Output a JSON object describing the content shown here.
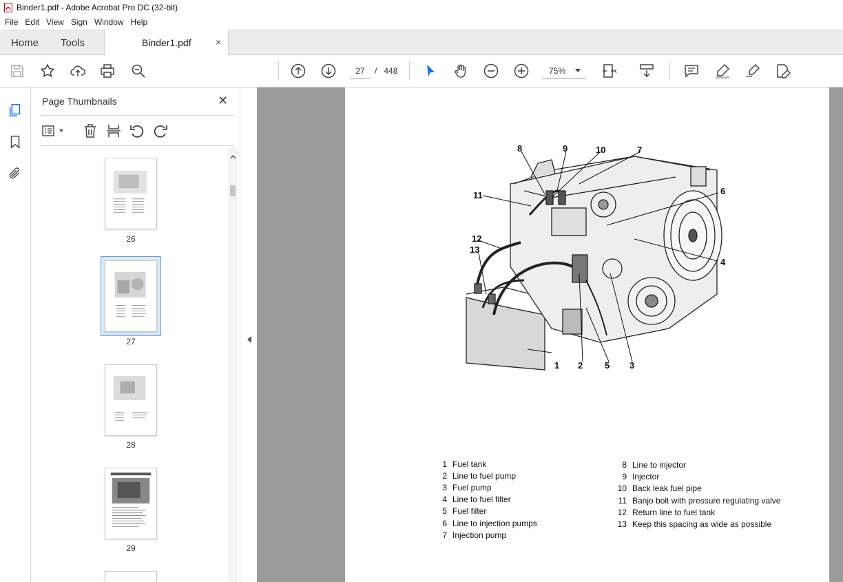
{
  "window": {
    "title": "Binder1.pdf - Adobe Acrobat Pro DC (32-bit)"
  },
  "menu": [
    "File",
    "Edit",
    "View",
    "Sign",
    "Window",
    "Help"
  ],
  "tabs": {
    "home": "Home",
    "tools": "Tools",
    "document": "Binder1.pdf",
    "close": "×"
  },
  "toolbar": {
    "page_current": "27",
    "page_separator": "/",
    "page_total": "448",
    "zoom": "75%"
  },
  "panel": {
    "title": "Page Thumbnails",
    "close": "✕",
    "thumbnails": [
      {
        "label": "26"
      },
      {
        "label": "27"
      },
      {
        "label": "28"
      },
      {
        "label": "29"
      }
    ]
  },
  "figure": {
    "callouts": [
      "8",
      "9",
      "10",
      "7",
      "11",
      "6",
      "12",
      "13",
      "4",
      "1",
      "2",
      "5",
      "3"
    ]
  },
  "legend": {
    "left": [
      {
        "n": "1",
        "t": "Fuel tank"
      },
      {
        "n": "2",
        "t": "Line to fuel pump"
      },
      {
        "n": "3",
        "t": "Fuel pump"
      },
      {
        "n": "4",
        "t": "Line to fuel filter"
      },
      {
        "n": "5",
        "t": "Fuel filter"
      },
      {
        "n": "6",
        "t": "Line to injection pumps"
      },
      {
        "n": "7",
        "t": "Injection pump"
      }
    ],
    "right": [
      {
        "n": "8",
        "t": "Line to injector"
      },
      {
        "n": "9",
        "t": "Injector"
      },
      {
        "n": "10",
        "t": "Back leak fuel pipe"
      },
      {
        "n": "11",
        "t": "Banjo bolt with pressure regulating valve"
      },
      {
        "n": "12",
        "t": "Return line to fuel tank"
      },
      {
        "n": "13",
        "t": "Keep this spacing as wide as possible"
      }
    ]
  }
}
